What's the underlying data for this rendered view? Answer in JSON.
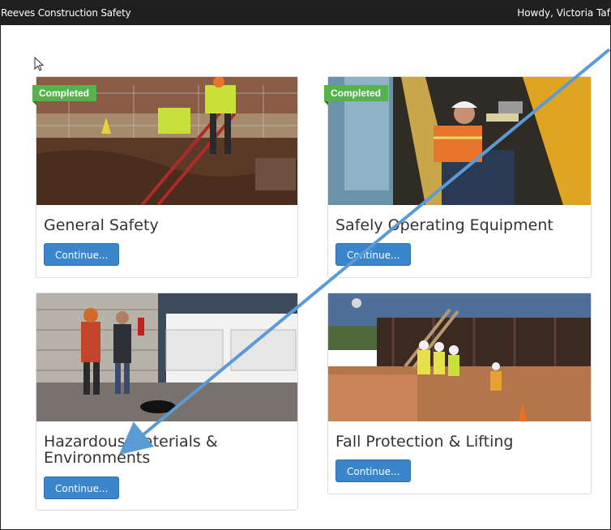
{
  "topbar": {
    "brand": "Reeves Construction Safety",
    "greeting": "Howdy, Victoria Taf"
  },
  "courses": [
    {
      "title": "General Safety",
      "badge": "Completed",
      "button": "Continue..."
    },
    {
      "title": "Safely Operating Equipment",
      "badge": "Completed",
      "button": "Continue..."
    },
    {
      "title_line1": "Hazardous Materials &",
      "title_line2": "Environments",
      "button": "Continue..."
    },
    {
      "title": "Fall Protection & Lifting",
      "button": "Continue..."
    }
  ],
  "colors": {
    "topbar": "#1f1f1f",
    "button": "#3a85cc",
    "badge": "#56b24d",
    "annotation_arrow": "#5b9bd5"
  },
  "icons": [
    "mouse-pointer-icon",
    "annotation-arrow"
  ]
}
